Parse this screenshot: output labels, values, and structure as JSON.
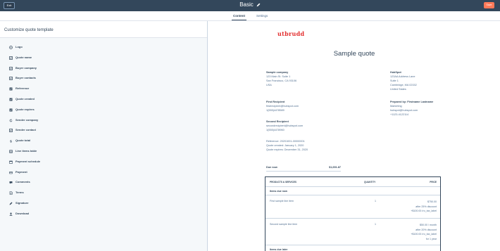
{
  "topbar": {
    "exit_label": "Exit",
    "title": "Basic",
    "save_label": "Save"
  },
  "tabs": [
    {
      "label": "Content"
    },
    {
      "label": "Settings"
    }
  ],
  "sidebar": {
    "header": "Customize quote template",
    "items": [
      {
        "label": "Logo",
        "icon": "image-icon"
      },
      {
        "label": "Quote name",
        "icon": "checkbox-icon"
      },
      {
        "label": "Buyer company",
        "icon": "checkbox-icon"
      },
      {
        "label": "Buyer contacts",
        "icon": "checkbox-icon"
      },
      {
        "label": "Reference",
        "icon": "checkbox-icon"
      },
      {
        "label": "Quote created",
        "icon": "checkbox-icon"
      },
      {
        "label": "Quote expires",
        "icon": "checkbox-icon"
      },
      {
        "label": "Sender company",
        "icon": "refresh-icon"
      },
      {
        "label": "Sender contact",
        "icon": "checkbox-icon"
      },
      {
        "label": "Quote total",
        "icon": "dollar-icon"
      },
      {
        "label": "Line items table",
        "icon": "table-icon"
      },
      {
        "label": "Payment schedule",
        "icon": "calendar-icon"
      },
      {
        "label": "Payment",
        "icon": "card-icon"
      },
      {
        "label": "Comments",
        "icon": "chat-icon"
      },
      {
        "label": "Terms",
        "icon": "file-icon"
      },
      {
        "label": "Signature",
        "icon": "pen-icon"
      },
      {
        "label": "Download",
        "icon": "person-icon"
      }
    ]
  },
  "preview": {
    "logo": "utbrudd",
    "title": "Sample quote",
    "buyer": {
      "company": "Sample company",
      "address1": "123 Main St. Suite 1",
      "address2": "San Francisco, CA 93106",
      "country": "USA"
    },
    "seller": {
      "company": "HubSpot",
      "address1": "123AA Address Lane",
      "address2": "Suite 1",
      "address3": "Cambridge, MA 02152",
      "country": "United States"
    },
    "first_recipient": {
      "label": "First Recipient",
      "email": "firstrecipient@hubspot.com",
      "phone": "1(555)4478589"
    },
    "second_recipient": {
      "label": "Second Recipient",
      "email": "secondrecipient@hubspot.com",
      "phone": "1(555)4478960"
    },
    "prepared_by": {
      "label": "Prepared by: Firstname Lastname",
      "role": "Marketing",
      "email": "hubspot@hubspot.com",
      "phone": "+1123-4122114"
    },
    "reference": "Reference: 20201001-00000001",
    "created": "Quote created: January 1, 2020",
    "expires": "Quote expires: December 31, 2020",
    "due_label": "Due now",
    "due_amount": "$1,651.87",
    "table": {
      "col_products": "PRODUCTS & SERVICES",
      "col_quantity": "QUANTITY",
      "col_price": "PRICE",
      "section_due_now": "Items due now",
      "section_due_later": "Items due later",
      "rows": [
        {
          "name": "First sample line item",
          "qty": "1",
          "price1": "$750.00",
          "price2": "after 25% discount",
          "price3": "+$100.00 /ro_tax_label"
        },
        {
          "name": "Second sample line item",
          "qty": "1",
          "price1": "$50.00 / month",
          "price2": "after 20% discount",
          "price3": "+$100.00 /ro_tax_label",
          "price4": "for 1 year"
        }
      ]
    }
  }
}
